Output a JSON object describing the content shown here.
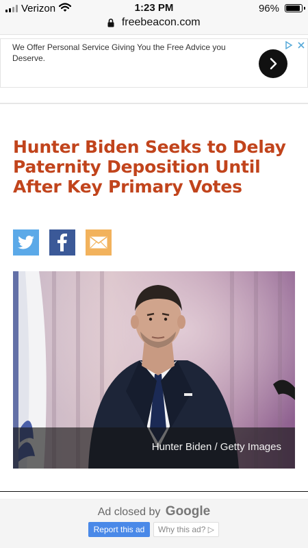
{
  "status_bar": {
    "carrier": "Verizon",
    "time": "1:23 PM",
    "battery": "96%",
    "battery_level": 0.96
  },
  "browser": {
    "url": "freebeacon.com"
  },
  "ad_banner": {
    "text": "We Offer Personal Service Giving You the Free Advice you Deserve."
  },
  "article": {
    "headline": "Hunter Biden Seeks to Delay Paternity Deposition Until After Key Primary Votes",
    "share": [
      {
        "name": "twitter",
        "icon": "twitter-icon",
        "color": "#5ba9e8"
      },
      {
        "name": "facebook",
        "icon": "facebook-icon",
        "color": "#3b5998"
      },
      {
        "name": "email",
        "icon": "email-icon",
        "color": "#f2b25c"
      }
    ],
    "photo_caption": "Hunter Biden / Getty Images"
  },
  "ad_closed": {
    "prefix": "Ad closed by",
    "brand": "Google",
    "report_label": "Report this ad",
    "why_label": "Why this ad? ▷"
  },
  "colors": {
    "headline": "#c1441c",
    "report_button": "#4a89e8"
  }
}
